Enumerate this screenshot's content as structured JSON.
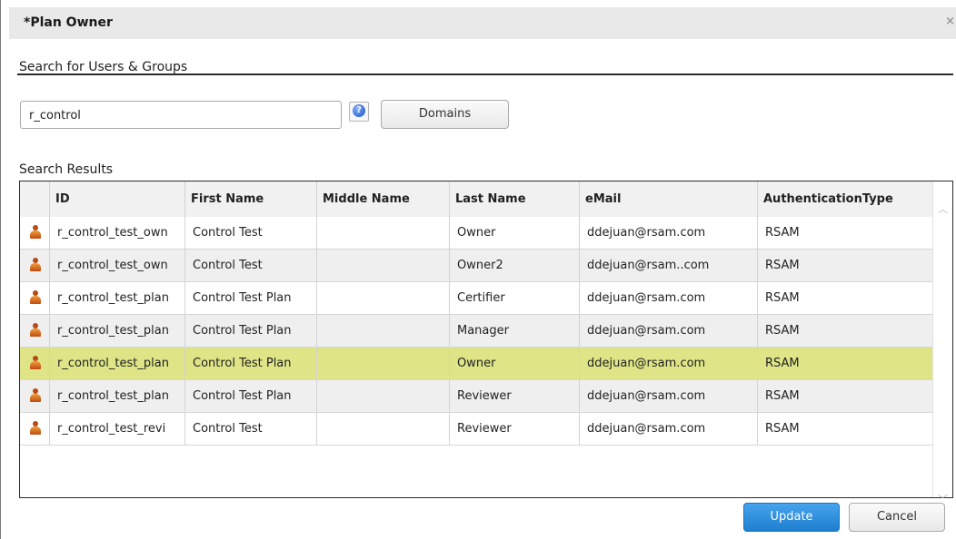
{
  "dialog": {
    "title": "*Plan Owner",
    "close_glyph": "×"
  },
  "search": {
    "section_title": "Search for Users & Groups",
    "value": "r_control",
    "help_icon": "help-icon",
    "domains_label": "Domains"
  },
  "results": {
    "label": "Search Results",
    "columns": [
      "ID",
      "First Name",
      "Middle Name",
      "Last Name",
      "eMail",
      "AuthenticationType"
    ],
    "rows": [
      {
        "icon": "user-icon",
        "id": "r_control_test_own",
        "first": "Control Test",
        "middle": "",
        "last": "Owner",
        "email": "ddejuan@rsam.com",
        "auth": "RSAM"
      },
      {
        "icon": "user-icon",
        "id": "r_control_test_own",
        "first": "Control Test",
        "middle": "",
        "last": "Owner2",
        "email": "ddejuan@rsam..com",
        "auth": "RSAM"
      },
      {
        "icon": "user-icon",
        "id": "r_control_test_plan",
        "first": "Control Test Plan",
        "middle": "",
        "last": "Certifier",
        "email": "ddejuan@rsam.com",
        "auth": "RSAM"
      },
      {
        "icon": "user-icon",
        "id": "r_control_test_plan",
        "first": "Control Test Plan",
        "middle": "",
        "last": "Manager",
        "email": "ddejuan@rsam.com",
        "auth": "RSAM"
      },
      {
        "icon": "user-icon",
        "id": "r_control_test_plan",
        "first": "Control Test Plan",
        "middle": "",
        "last": "Owner",
        "email": "ddejuan@rsam.com",
        "auth": "RSAM",
        "selected": true
      },
      {
        "icon": "user-icon",
        "id": "r_control_test_plan",
        "first": "Control Test Plan",
        "middle": "",
        "last": "Reviewer",
        "email": "ddejuan@rsam.com",
        "auth": "RSAM"
      },
      {
        "icon": "user-icon",
        "id": "r_control_test_revi",
        "first": "Control Test",
        "middle": "",
        "last": "Reviewer",
        "email": "ddejuan@rsam.com",
        "auth": "RSAM"
      }
    ]
  },
  "actions": {
    "update_label": "Update",
    "cancel_label": "Cancel"
  },
  "colors": {
    "selected_row": "#dfe586",
    "primary_button": "#2d8de0"
  }
}
